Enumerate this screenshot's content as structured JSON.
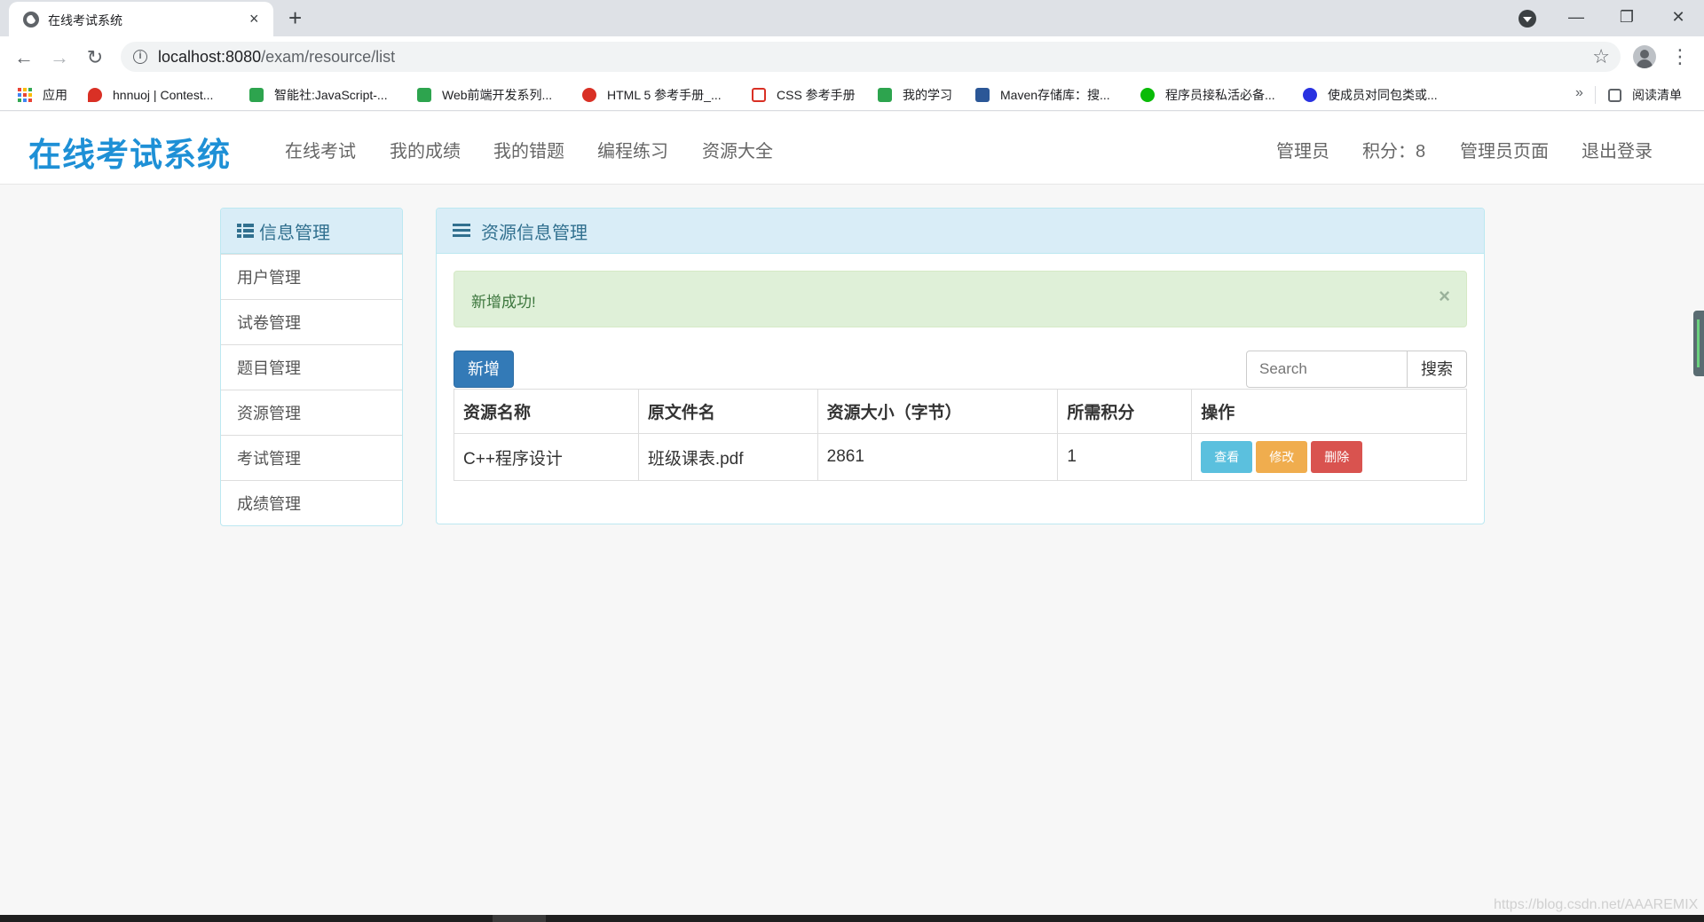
{
  "browser": {
    "tab_title": "在线考试系统",
    "tab_close": "×",
    "new_tab": "+",
    "window": {
      "minimize": "—",
      "maximize": "❐",
      "close": "✕"
    },
    "nav": {
      "back": "←",
      "forward": "→",
      "reload": "↻"
    },
    "url_host": "localhost:8080",
    "url_path": "/exam/resource/list",
    "star": "☆",
    "menu": "⋮",
    "bookmarks": [
      {
        "label": "应用",
        "icon": "apps-grid-icon"
      },
      {
        "label": "hnnuoj | Contest...",
        "icon": "pin-icon",
        "color": "#d93025"
      },
      {
        "label": "智能社:JavaScript-...",
        "icon": "bookmark-green-icon",
        "color": "#2da44e"
      },
      {
        "label": "Web前端开发系列...",
        "icon": "bookmark-green-icon",
        "color": "#2da44e"
      },
      {
        "label": "HTML 5 参考手册_...",
        "icon": "owl-icon",
        "color": "#d93025"
      },
      {
        "label": "CSS 参考手册",
        "icon": "css-icon",
        "color": "#d93025"
      },
      {
        "label": "我的学习",
        "icon": "bookmark-green-icon",
        "color": "#2da44e"
      },
      {
        "label": "Maven存储库：搜...",
        "icon": "mvn-icon",
        "color": "#2b5797"
      },
      {
        "label": "程序员接私活必备...",
        "icon": "wechat-icon",
        "color": "#09bb07"
      },
      {
        "label": "使成员对同包类或...",
        "icon": "baidu-icon",
        "color": "#2932e1"
      }
    ],
    "bookmarks_more": "»",
    "reading_list": "阅读清单"
  },
  "navbar": {
    "brand": "在线考试系统",
    "links": [
      "在线考试",
      "我的成绩",
      "我的错题",
      "编程练习",
      "资源大全"
    ],
    "user": "管理员",
    "points": "积分：8",
    "admin_page": "管理员页面",
    "logout": "退出登录"
  },
  "sidebar": {
    "title": "信息管理",
    "items": [
      "用户管理",
      "试卷管理",
      "题目管理",
      "资源管理",
      "考试管理",
      "成绩管理"
    ]
  },
  "panel": {
    "title": "资源信息管理",
    "alert": "新增成功!",
    "alert_close": "×",
    "add_button": "新增",
    "search_placeholder": "Search",
    "search_button": "搜索",
    "columns": [
      "资源名称",
      "原文件名",
      "资源大小（字节）",
      "所需积分",
      "操作"
    ],
    "rows": [
      {
        "name": "C++程序设计",
        "filename": "班级课表.pdf",
        "size": "2861",
        "points": "1",
        "actions": {
          "view": "查看",
          "edit": "修改",
          "delete": "删除"
        }
      }
    ]
  },
  "watermark": "https://blog.csdn.net/AAAREMIX",
  "colors": {
    "brand": "#1e90d6",
    "primary": "#337ab7",
    "info": "#5bc0de",
    "warning": "#f0ad4e",
    "danger": "#d9534f",
    "success_bg": "#dff0d8"
  }
}
